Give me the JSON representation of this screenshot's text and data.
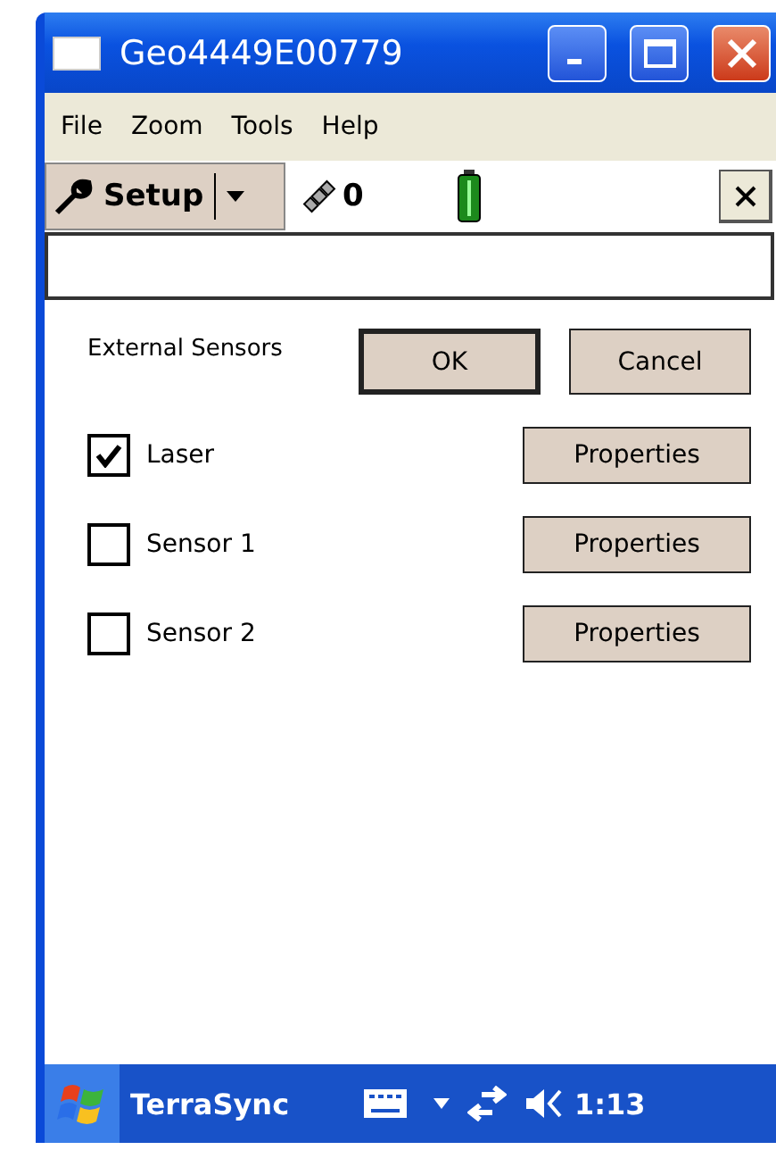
{
  "window": {
    "title": "Geo4449E00779"
  },
  "menu": [
    "File",
    "Zoom",
    "Tools",
    "Help"
  ],
  "toolbar": {
    "setup_label": "Setup",
    "satellite_count": "0"
  },
  "dialog": {
    "title": "External Sensors",
    "ok": "OK",
    "cancel": "Cancel",
    "sensors": [
      {
        "name": "Laser",
        "checked": true,
        "button": "Properties"
      },
      {
        "name": "Sensor 1",
        "checked": false,
        "button": "Properties"
      },
      {
        "name": "Sensor 2",
        "checked": false,
        "button": "Properties"
      }
    ]
  },
  "taskbar": {
    "app": "TerraSync",
    "time": "1:13"
  }
}
